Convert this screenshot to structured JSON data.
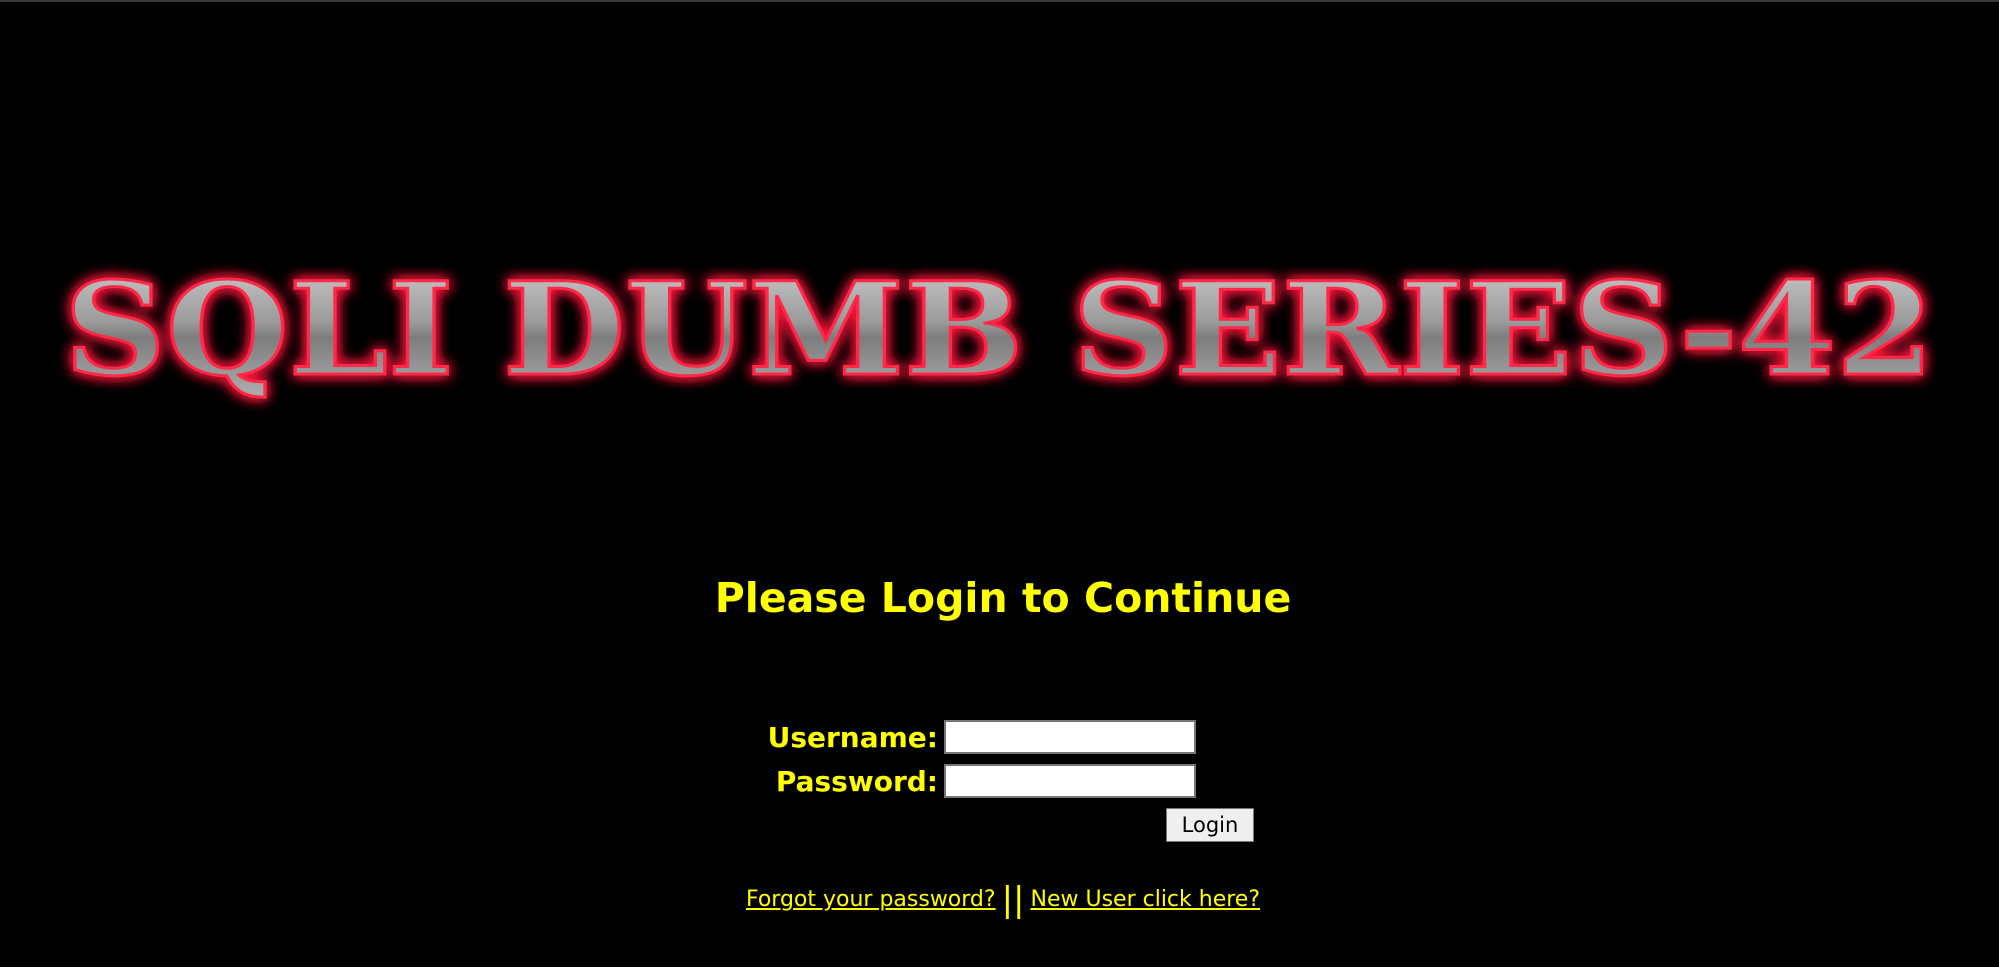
{
  "banner": {
    "text": "SQLI DUMB SERIES-42"
  },
  "heading": "Please Login to Continue",
  "form": {
    "username_label": "Username:",
    "password_label": "Password:",
    "username_value": "",
    "password_value": "",
    "login_button": "Login"
  },
  "links": {
    "forgot_password": "Forgot your password?",
    "separator": "||",
    "new_user": "New User click here?"
  },
  "colors": {
    "background": "#000000",
    "text": "#ffff00",
    "banner_glow": "#ff1a3c",
    "banner_fill": "#9a9a9a"
  }
}
